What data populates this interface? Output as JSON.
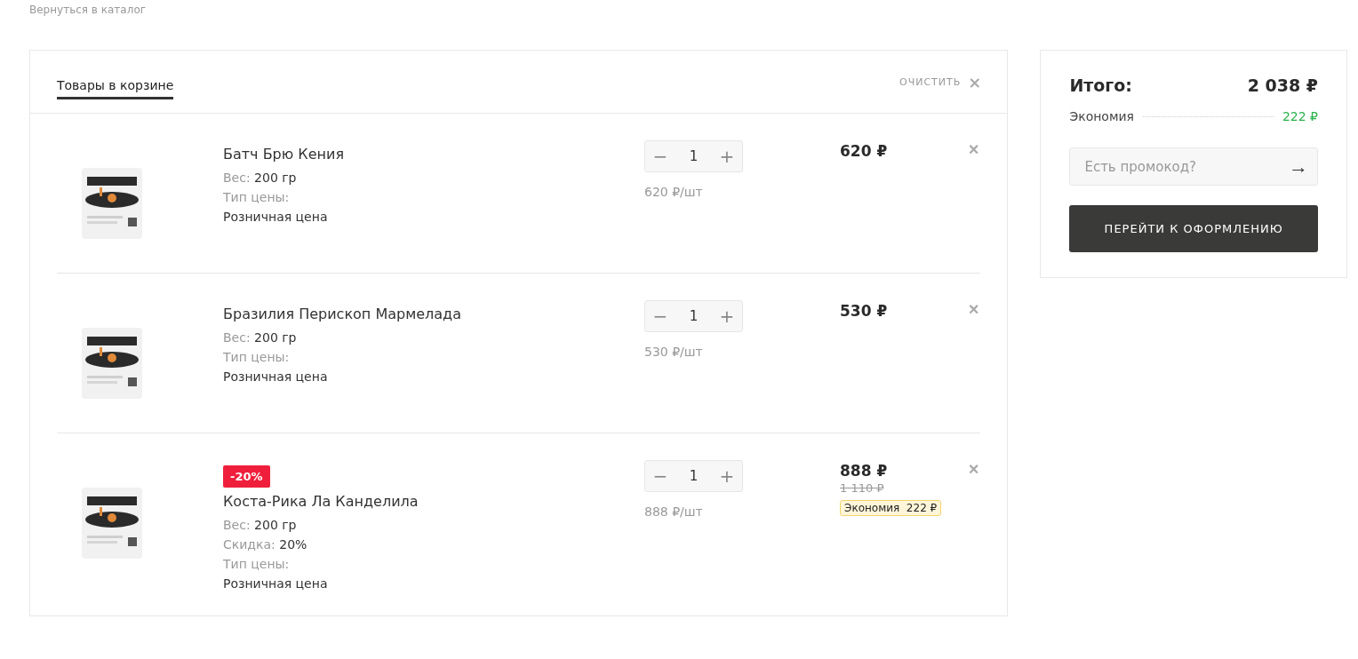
{
  "back_link": "Вернуться в каталог",
  "cart": {
    "tab": {
      "label": "Товары в корзине",
      "selected": true
    },
    "clear": {
      "label": "ОЧИСТИТЬ",
      "icon": "×"
    },
    "items": [
      {
        "kind": "picture",
        "name": "Батч Брю Кения",
        "props": [
          {
            "label": "Вес:",
            "value": "200 гр"
          },
          {
            "label": "Тип цены:",
            "value": "Розничная цена"
          }
        ],
        "quantity": "1",
        "minus": "−",
        "plus": "+",
        "unit_price": "620 ₽/шт",
        "price": "620 ₽",
        "remove": "×"
      },
      {
        "kind": "picture",
        "name": "Бразилия Перископ Мармелада",
        "props": [
          {
            "label": "Вес:",
            "value": "200 гр"
          },
          {
            "label": "Тип цены:",
            "value": "Розничная цена"
          }
        ],
        "quantity": "1",
        "minus": "−",
        "plus": "+",
        "unit_price": "530 ₽/шт",
        "price": "530 ₽",
        "remove": "×"
      },
      {
        "kind": "picture",
        "badge": "-20%",
        "name": "Коста-Рика Ла Канделила",
        "props": [
          {
            "label": "Вес:",
            "value": "200 гр"
          },
          {
            "label": "Скидка:",
            "value": "20%"
          },
          {
            "label": "Тип цены:",
            "value": "Розничная цена"
          }
        ],
        "quantity": "1",
        "minus": "−",
        "plus": "+",
        "unit_price": "888 ₽/шт",
        "price": "888 ₽",
        "old_price": "1 110 ₽",
        "saving": {
          "label": "Экономия",
          "value": "222 ₽"
        },
        "remove": "×"
      }
    ]
  },
  "summary": {
    "total_label": "Итого:",
    "total": "2 038 ₽",
    "saving_label": "Экономия",
    "saving": "222 ₽",
    "promo": {
      "placeholder": "Есть промокод?",
      "arrow": "→"
    },
    "checkout": "ПЕРЕЙТИ К ОФОРМЛЕНИЮ"
  }
}
